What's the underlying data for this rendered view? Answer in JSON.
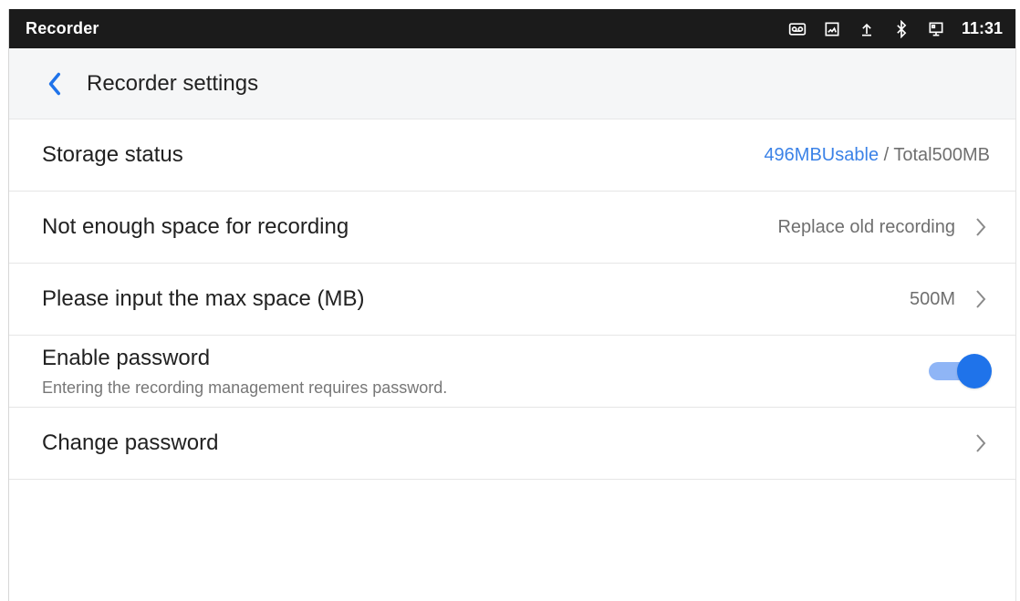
{
  "statusbar": {
    "app_name": "Recorder",
    "time": "11:31",
    "icons": [
      "voicemail-icon",
      "image-icon",
      "upload-icon",
      "bluetooth-icon",
      "screen-icon"
    ]
  },
  "header": {
    "title": "Recorder settings",
    "back_icon": "chevron-left-icon"
  },
  "settings": {
    "storage": {
      "label": "Storage status",
      "usable": "496MBUsable",
      "separator": " / ",
      "total": "Total500MB"
    },
    "space_policy": {
      "label": "Not enough space for recording",
      "value": "Replace old recording"
    },
    "max_space": {
      "label": "Please input the max space (MB)",
      "value": "500M"
    },
    "password": {
      "label": "Enable password",
      "description": "Entering the recording management requires password.",
      "enabled": true
    },
    "change_password": {
      "label": "Change password"
    }
  },
  "colors": {
    "accent": "#1f73ea",
    "status_bar": "#1b1b1b",
    "title_bar": "#f5f6f7",
    "storage_usable": "#3b82e7"
  }
}
